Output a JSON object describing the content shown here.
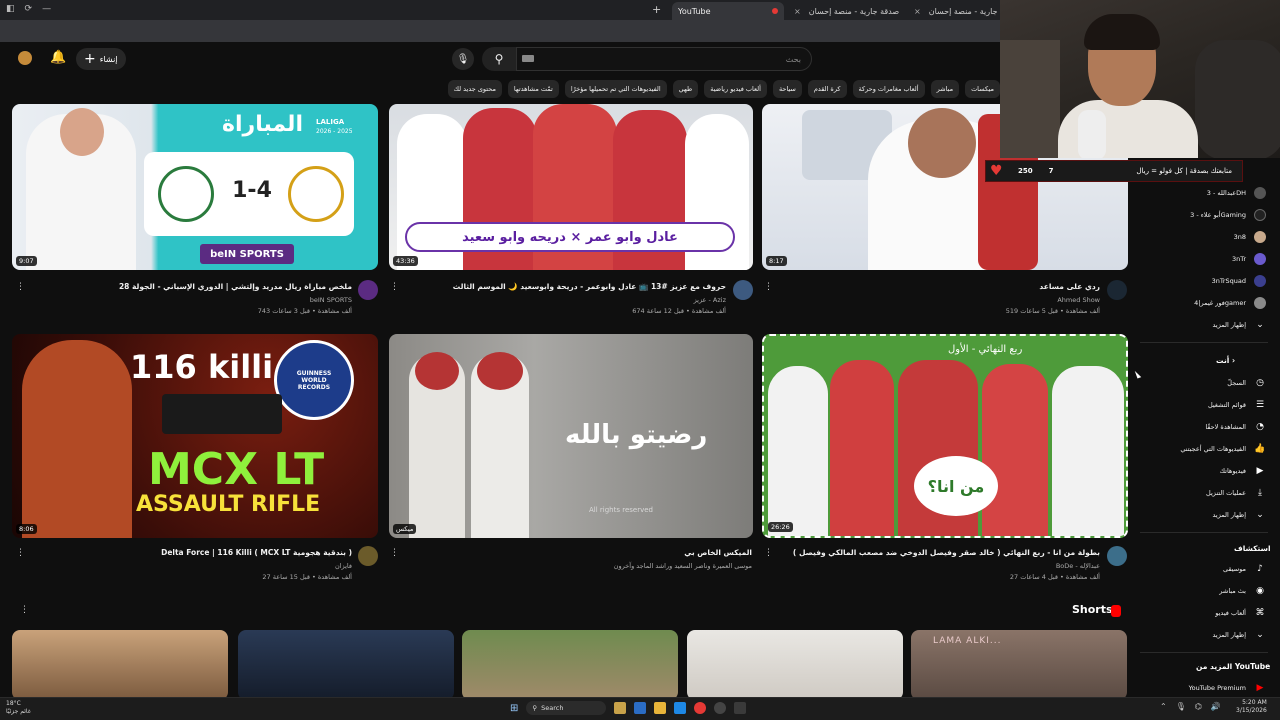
{
  "browser": {
    "tabs": [
      {
        "label": "صدقة جارية - منصة إحسان",
        "active": false
      },
      {
        "label": "صدقة جارية - منصة إحسان",
        "active": false
      },
      {
        "label": "YouTube",
        "active": true
      }
    ],
    "new_tab": "+",
    "close_glyph": "×"
  },
  "header": {
    "create_label": "إنشاء",
    "search_placeholder": "بحث",
    "icons": [
      "bell-icon",
      "mic-icon",
      "search-icon",
      "plus-icon"
    ]
  },
  "chips": [
    "ميكسات",
    "مباشر",
    "ألعاب مغامرات وحركة",
    "كرة القدم",
    "سياحة",
    "ألعاب فيديو رياضية",
    "طهي",
    "الفيديوهات التي تم تحميلها مؤخرًا",
    "تمّت مشاهدتها",
    "محتوى جديد لك"
  ],
  "videos": [
    {
      "title": "ملخص مباراة ريال مدريد وإلتشي | الدوري الإسباني - الجولة 28",
      "channel": "beIN SPORTS",
      "stats": "743 ألف مشاهدة • قبل 3 ساعات",
      "duration": "9:07"
    },
    {
      "title": "حروف مع عزيز #13 📺 عادل وابوعمر - دريحة وابوسعيد 🌙 الموسم الثالث",
      "channel": "عزيز - Aziz",
      "stats": "674 ألف مشاهدة • قبل 12 ساعة",
      "duration": "43:36"
    },
    {
      "title": "ردي على مساعد",
      "channel": "Ahmed Show",
      "stats": "519 ألف مشاهدة • قبل 5 ساعات",
      "duration": "8:17"
    },
    {
      "title": "Delta Force | 116 Killi ( MCX LT بندقية هجومية )",
      "channel": "فايزان",
      "stats": "27 ألف مشاهدة • قبل 15 ساعة",
      "duration": "8:06"
    },
    {
      "title": "الميكس الخاص بي",
      "channel": "موسى العميرة وناصر السعيد وراشد الماجد وآخرون",
      "stats": "",
      "duration": "ميكس"
    },
    {
      "title": "بطولة من انا - ربع النهائي ( خالد صقر وفيصل الدوخي ضد مصعب المالكي وفيصل )",
      "channel": "BoDe - عبدالإله",
      "stats": "27 ألف مشاهدة • قبل 4 ساعات",
      "duration": "26:26"
    }
  ],
  "thumb_text": {
    "t1_heading": "المباراة",
    "t1_league": "LALIGA",
    "t1_season": "2026 - 2025",
    "t1_score": "1-4",
    "t1_network": "beIN SPORTS",
    "t2_banner": "عادل وابو عمر × دريحه وابو سعيد",
    "t4_top": "116 killi",
    "t4_badge": "GUINNESS WORLD RECORDS",
    "t4_main": "MCX LT",
    "t4_sub": "ASSAULT RIFLE",
    "t5_text": "رضيتو بالله",
    "t5_wm": "All rights reserved",
    "t6_label": "ربع النهائي - الأول",
    "t6_logo": "من انا؟"
  },
  "shorts": {
    "label": "Shorts",
    "t5_overlay": "LAMA ALKI..."
  },
  "sidebar": {
    "subs": [
      {
        "label": "عبدالله - 3DH"
      },
      {
        "label": "أبو علاء - 3Gaming"
      },
      {
        "label": "3n8"
      },
      {
        "label": "3nTr"
      },
      {
        "label": "3nTrSquad"
      },
      {
        "label": "فور غيمر|4gamer"
      }
    ],
    "show_more_1": "إظهار المزيد",
    "you_heading": "أنت",
    "you_items": [
      {
        "label": "السجلّ",
        "icon": "history-icon"
      },
      {
        "label": "قوائم التشغيل",
        "icon": "playlist-icon"
      },
      {
        "label": "المشاهدة لاحقًا",
        "icon": "watch-later-icon"
      },
      {
        "label": "الفيديوهات التي أعجبتني",
        "icon": "like-icon"
      },
      {
        "label": "فيديوهاتك",
        "icon": "your-videos-icon"
      },
      {
        "label": "عمليات التنزيل",
        "icon": "download-icon"
      }
    ],
    "show_more_2": "إظهار المزيد",
    "explore_heading": "استكشاف",
    "explore_items": [
      {
        "label": "موسيقى",
        "icon": "music-icon"
      },
      {
        "label": "بث مباشر",
        "icon": "live-icon"
      },
      {
        "label": "ألعاب فيديو",
        "icon": "gaming-icon"
      }
    ],
    "show_more_3": "إظهار المزيد",
    "more_heading": "المزيد من YouTube",
    "premium": "YouTube Premium"
  },
  "donation": {
    "text": "متابعتك بصدقة | كل فولو = ريال",
    "count_a": "250",
    "count_b": "7"
  },
  "taskbar": {
    "weather_temp": "18°C",
    "weather_desc": "غائم جزئيًا",
    "search": "Search",
    "time": "5:20 AM",
    "date": "3/15/2026"
  },
  "colors": {
    "accent": "#ff0000",
    "bg": "#0f0f0f",
    "chip": "#272727"
  }
}
